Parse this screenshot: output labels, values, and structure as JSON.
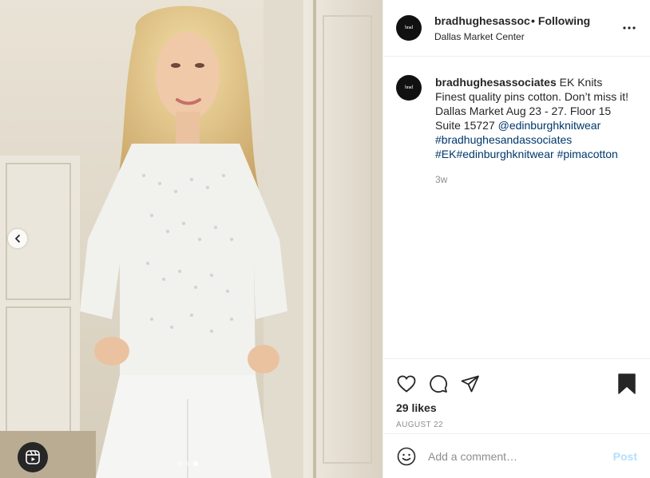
{
  "header": {
    "username": "bradhughesassociates",
    "separator": "•",
    "follow_label": "Following",
    "location": "Dallas Market Center",
    "avatar_text": "brad"
  },
  "caption": {
    "username": "bradhughesassociates",
    "text": "EK Knits Finest quality pins cotton. Don’t miss it! Dallas Market Aug 23 - 27. Floor 15 Suite 15727",
    "mention": "@edinburghknitwear",
    "tag1": "#bradhughesandassociates",
    "tag2": "#EK",
    "tag3": "#edinburghknitwear",
    "tag4": "#pimacotton",
    "time": "3w"
  },
  "engagement": {
    "likes": "29 likes",
    "date": "AUGUST 22"
  },
  "comment": {
    "placeholder": "Add a comment…",
    "post_label": "Post"
  },
  "carousel": {
    "total": 3,
    "active_index": 2
  },
  "icons": {
    "like": "heart-icon",
    "comment": "comment-icon",
    "share": "paper-plane-icon",
    "save": "bookmark-icon",
    "more": "more-horizontal-icon",
    "emoji": "smiley-icon",
    "prev": "chevron-left-icon",
    "reels": "reels-icon"
  },
  "colors": {
    "link": "#00376b",
    "post_disabled": "#b2dffc",
    "muted": "#8e8e8e"
  }
}
